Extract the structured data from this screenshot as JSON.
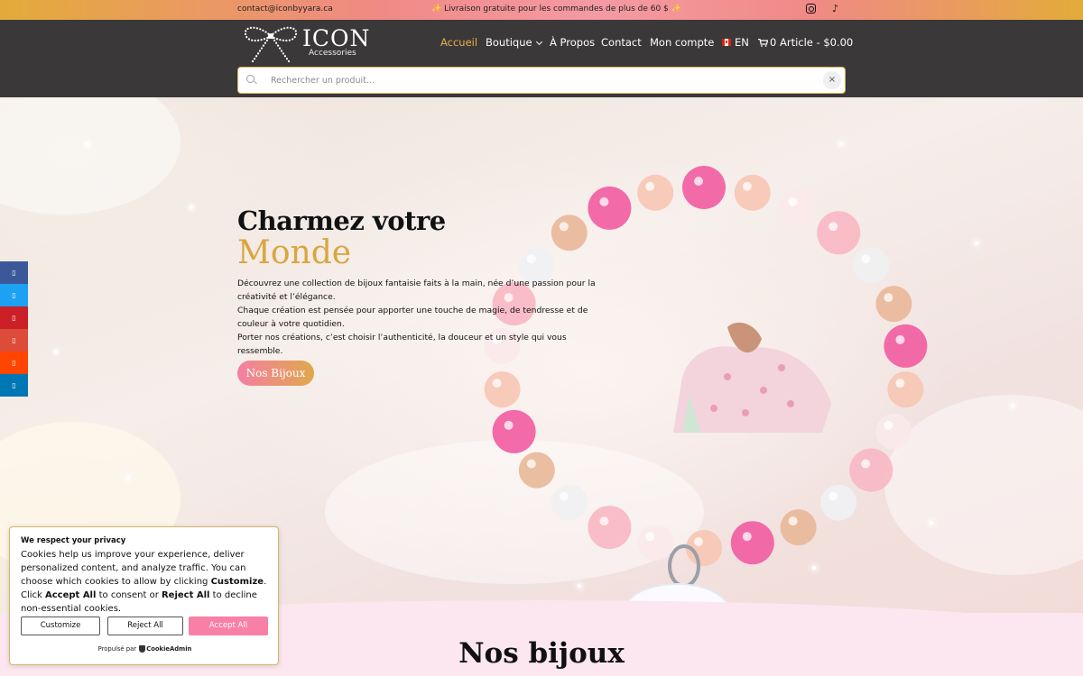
{
  "topbar": {
    "email": "contact@iconbyyara.ca",
    "promo": "✨ Livraison gratuite pour les commandes de plus de 60 $ ✨",
    "social_icons": [
      "instagram-icon",
      "tiktok-icon"
    ]
  },
  "brand": {
    "name": "ICON",
    "tagline": "Accessories"
  },
  "nav": {
    "home": "Accueil",
    "shop": "Boutique",
    "about": "À Propos",
    "contact": "Contact",
    "account": "Mon compte",
    "language": "EN",
    "cart": "0 Article - $0.00"
  },
  "search": {
    "placeholder": "Rechercher un produit...",
    "clear": "×"
  },
  "hero": {
    "title_line1": "Charmez votre",
    "title_line2": "Monde",
    "paragraph1": "Découvrez une collection de bijoux fantaisie faits à la main, née d’une passion pour la créativité et l’élégance.",
    "paragraph2": "Chaque création est pensée pour apporter une touche de magie, de tendresse et de couleur à votre quotidien.",
    "paragraph3": "Porter nos créations, c’est choisir l’authenticité, la douceur et un style qui vous ressemble.",
    "cta": "Nos Bijoux"
  },
  "share_bar": {
    "glyph": "▯",
    "colors": [
      "#3b5998",
      "#1da1f2",
      "#cb2027",
      "#dd4b39",
      "#ff4500",
      "#0077b5"
    ]
  },
  "section": {
    "title": "Nos bijoux"
  },
  "cookie": {
    "title": "We respect your privacy",
    "body_1": "Cookies help us improve your experience, deliver personalized content, and analyze traffic. You can choose which cookies to allow by clicking ",
    "body_customize": "Customize",
    "body_2": ". Click ",
    "body_accept": "Accept All",
    "body_3": " to consent or ",
    "body_reject": "Reject All",
    "body_4": " to decline non-essential cookies.",
    "customize_button": "Customize",
    "reject_button": "Reject All",
    "accept_button": "Accept All",
    "powered_prefix": "Propulsé par",
    "powered_brand": "CookieAdmin"
  },
  "colors": {
    "accent_gold": "#d9a63f",
    "accent_pink": "#f87fa6",
    "header_bg": "#3a3839"
  }
}
